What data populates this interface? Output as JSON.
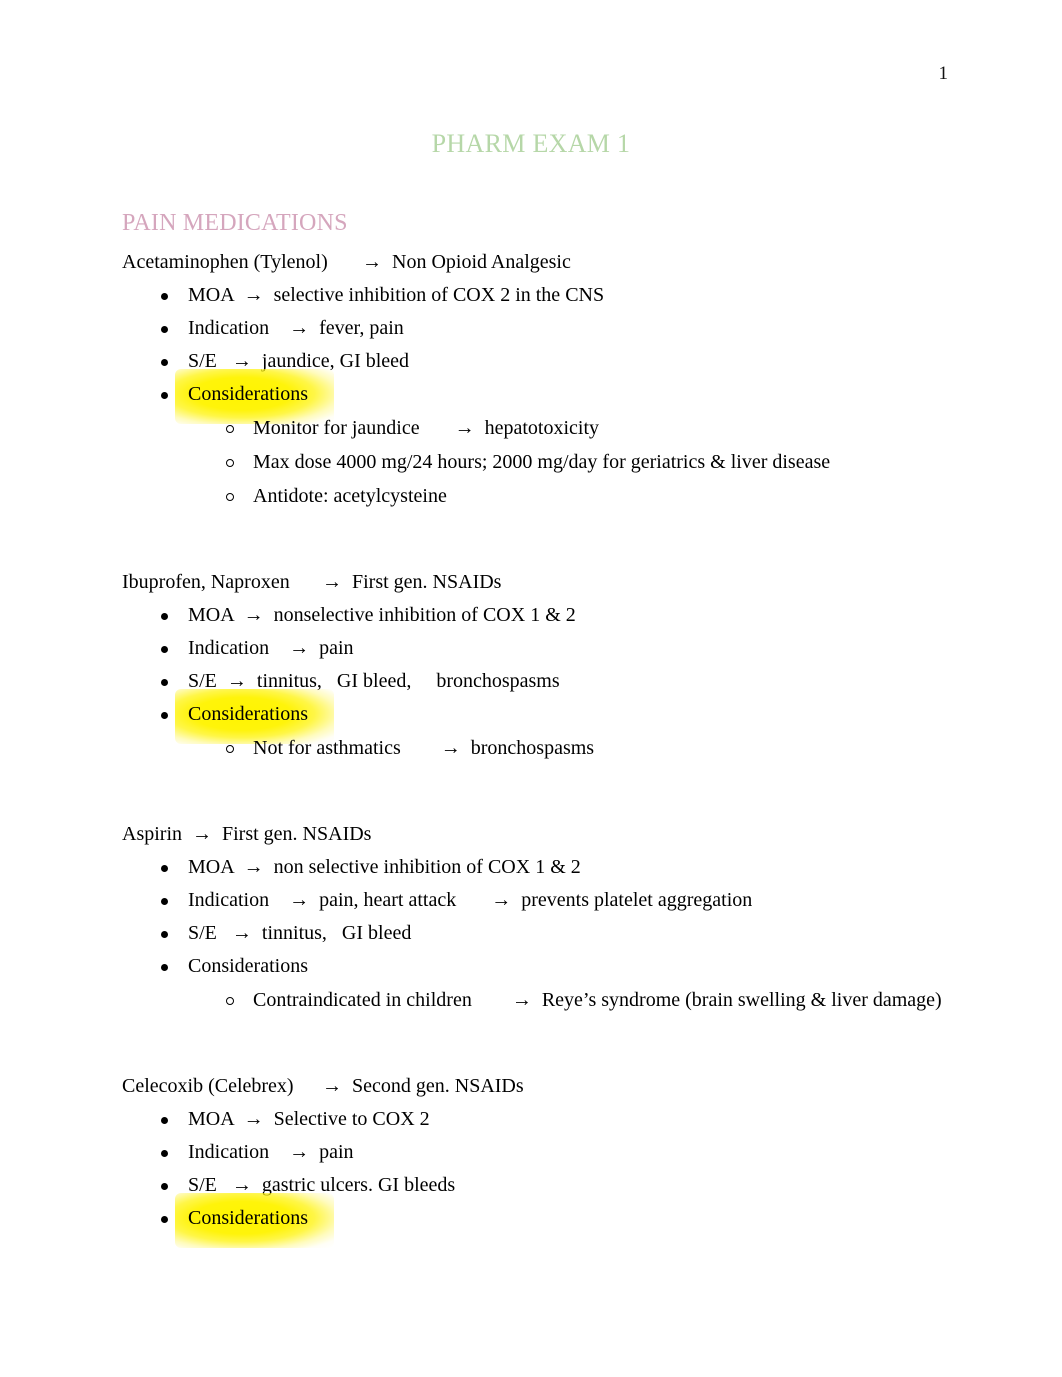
{
  "document": {
    "page_number": "1",
    "title": "PHARM EXAM 1",
    "title_color": "#b6d7a8",
    "heading_color": "#d5a6bd",
    "highlight_color": "#fff400"
  },
  "section": {
    "heading": "PAIN MEDICATIONS"
  },
  "drugs": [
    {
      "title": "Acetaminophen (Tylenol)\t→  Non Opioid Analgesic",
      "bullets": [
        {
          "text": "MOA  →  selective inhibition of COX 2 in the CNS",
          "highlighted": false
        },
        {
          "text": "Indication    →  fever, pain",
          "highlighted": false
        },
        {
          "text": "S/E   →  jaundice, GI bleed",
          "highlighted": false
        },
        {
          "text": "Considerations",
          "highlighted": true,
          "subbullets": [
            "Monitor for jaundice       →  hepatotoxicity",
            "Max dose 4000 mg/24 hours; 2000 mg/day for geriatrics & liver disease",
            "Antidote: acetylcysteine"
          ]
        }
      ]
    },
    {
      "title": "Ibuprofen, Naproxen\t→  First gen. NSAIDs",
      "bullets": [
        {
          "text": "MOA  →  nonselective inhibition of COX 1 & 2",
          "highlighted": false
        },
        {
          "text": "Indication    →  pain",
          "highlighted": false
        },
        {
          "text": "S/E  →  tinnitus,   GI bleed,     bronchospasms",
          "highlighted": false
        },
        {
          "text": "Considerations",
          "highlighted": true,
          "subbullets": [
            "Not for asthmatics        →  bronchospasms"
          ]
        }
      ]
    },
    {
      "title": "Aspirin  →  First gen. NSAIDs",
      "bullets": [
        {
          "text": "MOA  →  non selective inhibition of COX 1 & 2",
          "highlighted": false
        },
        {
          "text": "Indication    →  pain, heart attack       →  prevents platelet aggregation",
          "highlighted": false
        },
        {
          "text": "S/E   →  tinnitus,   GI bleed",
          "highlighted": false
        },
        {
          "text": "Considerations",
          "highlighted": false,
          "subbullets": [
            "Contraindicated in children        →  Reye’s syndrome (brain swelling & liver damage)"
          ]
        }
      ]
    },
    {
      "title": "Celecoxib (Celebrex)\t→  Second gen. NSAIDs",
      "bullets": [
        {
          "text": "MOA  →  Selective to COX 2",
          "highlighted": false
        },
        {
          "text": "Indication    →  pain",
          "highlighted": false
        },
        {
          "text": "S/E   →  gastric ulcers. GI bleeds",
          "highlighted": false
        },
        {
          "text": "Considerations",
          "highlighted": true,
          "subbullets": []
        }
      ]
    }
  ]
}
